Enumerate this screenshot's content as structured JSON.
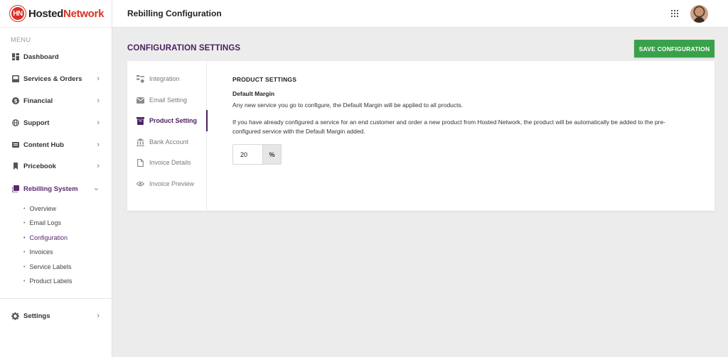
{
  "brand": {
    "mark": "HN",
    "name_part1": "Hosted",
    "name_part2": "Network"
  },
  "sidebar": {
    "menu_label": "MENU",
    "items": [
      {
        "label": "Dashboard",
        "icon": "dashboard-icon"
      },
      {
        "label": "Services  & Orders",
        "icon": "inbox-icon"
      },
      {
        "label": "Financial",
        "icon": "dollar-icon"
      },
      {
        "label": "Support",
        "icon": "globe-icon"
      },
      {
        "label": "Content Hub",
        "icon": "content-icon"
      },
      {
        "label": "Pricebook",
        "icon": "bookmark-icon"
      },
      {
        "label": "Rebilling System",
        "icon": "library-icon"
      },
      {
        "label": "Settings",
        "icon": "gear-icon"
      }
    ],
    "subitems": [
      {
        "label": "Overview"
      },
      {
        "label": "Email Logs"
      },
      {
        "label": "Configuration"
      },
      {
        "label": "Invoices"
      },
      {
        "label": "Service Labels"
      },
      {
        "label": "Product Labels"
      }
    ]
  },
  "header": {
    "title": "Rebilling Configuration"
  },
  "main": {
    "section_title": "CONFIGURATION SETTINGS",
    "save_label": "SAVE CONFIGURATION",
    "tabs": [
      {
        "label": "Integration",
        "icon": "integration-icon"
      },
      {
        "label": "Email Setting",
        "icon": "mail-icon"
      },
      {
        "label": "Product Setting",
        "icon": "archive-icon"
      },
      {
        "label": "Bank Account",
        "icon": "bank-icon"
      },
      {
        "label": "Invoice Details",
        "icon": "document-icon"
      },
      {
        "label": "Invoice Preview",
        "icon": "eye-icon"
      }
    ],
    "product": {
      "heading": "PRODUCT SETTINGS",
      "margin_heading": "Default Margin",
      "desc1": "Any new service you go to configure, the Default Margin will be applied to all products.",
      "desc2": "If you have already configured a service for an end customer and order a new product from Hosted Network, the product will be automatically be added to the pre-configured service with the Default Margin added.",
      "margin_value": "20",
      "margin_suffix": "%"
    }
  },
  "colors": {
    "accent": "#4b2160",
    "save": "#3aa14b",
    "brand_red": "#d93025"
  }
}
